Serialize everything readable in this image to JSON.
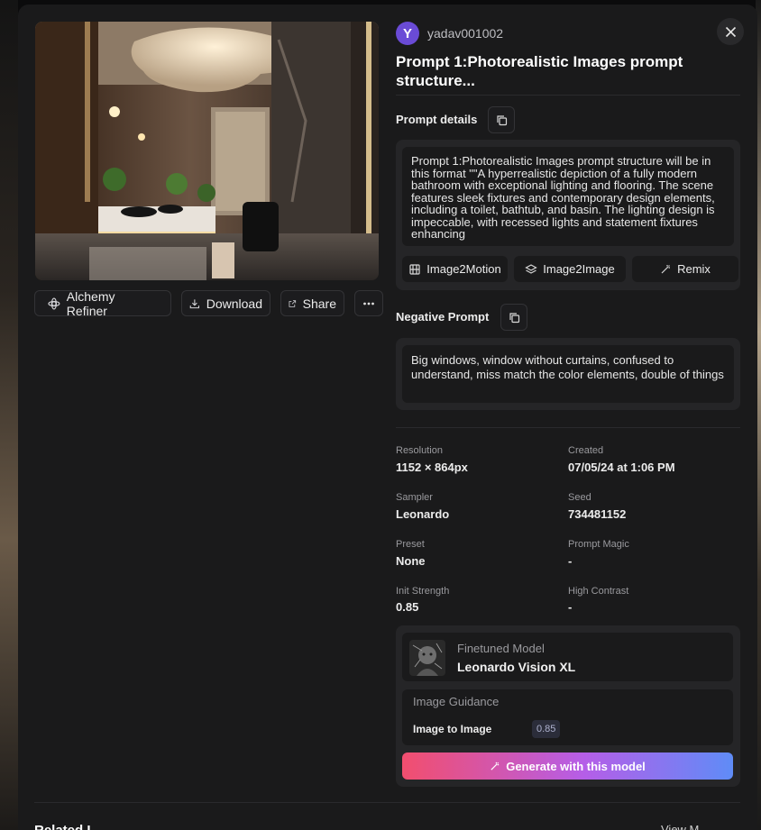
{
  "user": {
    "avatar_letter": "Y",
    "name": "yadav001002"
  },
  "title": "Prompt 1:Photorealistic Images prompt structure...",
  "actions": {
    "alchemy": "Alchemy Refiner",
    "download": "Download",
    "share": "Share"
  },
  "prompt": {
    "label": "Prompt details",
    "text": "Prompt 1:Photorealistic Images prompt structure will be in this format \"\"A hyperrealistic depiction of a fully modern bathroom with exceptional lighting and flooring. The scene features sleek fixtures and contemporary design elements, including a toilet, bathtub, and basin. The lighting design is impeccable, with recessed lights and statement fixtures enhancing",
    "tools": [
      "Image2Motion",
      "Image2Image",
      "Remix"
    ]
  },
  "negative": {
    "label": "Negative Prompt",
    "text": "Big windows, window without curtains, confused to understand, miss match the color elements, double of things"
  },
  "meta": [
    {
      "label": "Resolution",
      "value": "1152 × 864px"
    },
    {
      "label": "Created",
      "value": "07/05/24 at 1:06 PM"
    },
    {
      "label": "Sampler",
      "value": "Leonardo"
    },
    {
      "label": "Seed",
      "value": "734481152"
    },
    {
      "label": "Preset",
      "value": "None"
    },
    {
      "label": "Prompt Magic",
      "value": "-"
    },
    {
      "label": "Init Strength",
      "value": "0.85"
    },
    {
      "label": "High Contrast",
      "value": "-"
    }
  ],
  "model": {
    "label": "Finetuned Model",
    "name": "Leonardo Vision XL"
  },
  "guidance": {
    "title": "Image Guidance",
    "name": "Image to Image",
    "value": "0.85"
  },
  "generate_label": "Generate with this model",
  "bottom": {
    "title": "Related I...",
    "link": "View M..."
  },
  "colors": {
    "modal": "#1a1a1b",
    "accent_start": "#f24e6e",
    "accent_end": "#5f8cf7",
    "avatar": "#6a4bd6"
  }
}
